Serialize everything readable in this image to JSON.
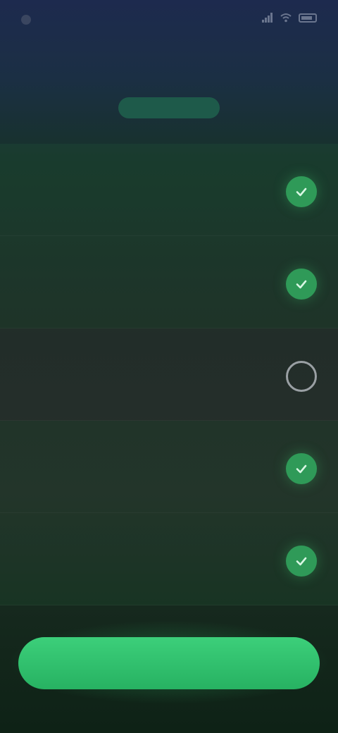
{
  "status_bar": {
    "time": "",
    "icons": [
      "signal-icon",
      "wifi-icon",
      "battery-icon"
    ]
  },
  "header": {
    "title": "",
    "subtitle": ""
  },
  "permissions": [
    {
      "title": "",
      "description": "",
      "enabled": true
    },
    {
      "title": "",
      "description": "",
      "enabled": true
    },
    {
      "title": "",
      "description": "",
      "enabled": false
    },
    {
      "title": "",
      "description": "",
      "enabled": true
    },
    {
      "title": "",
      "description": "",
      "enabled": true
    }
  ],
  "cta": {
    "label": ""
  },
  "colors": {
    "accent": "#2f9a58",
    "button": "#3ccf7a",
    "background_top": "#1d2a4e",
    "background_bottom": "#0e2216"
  }
}
